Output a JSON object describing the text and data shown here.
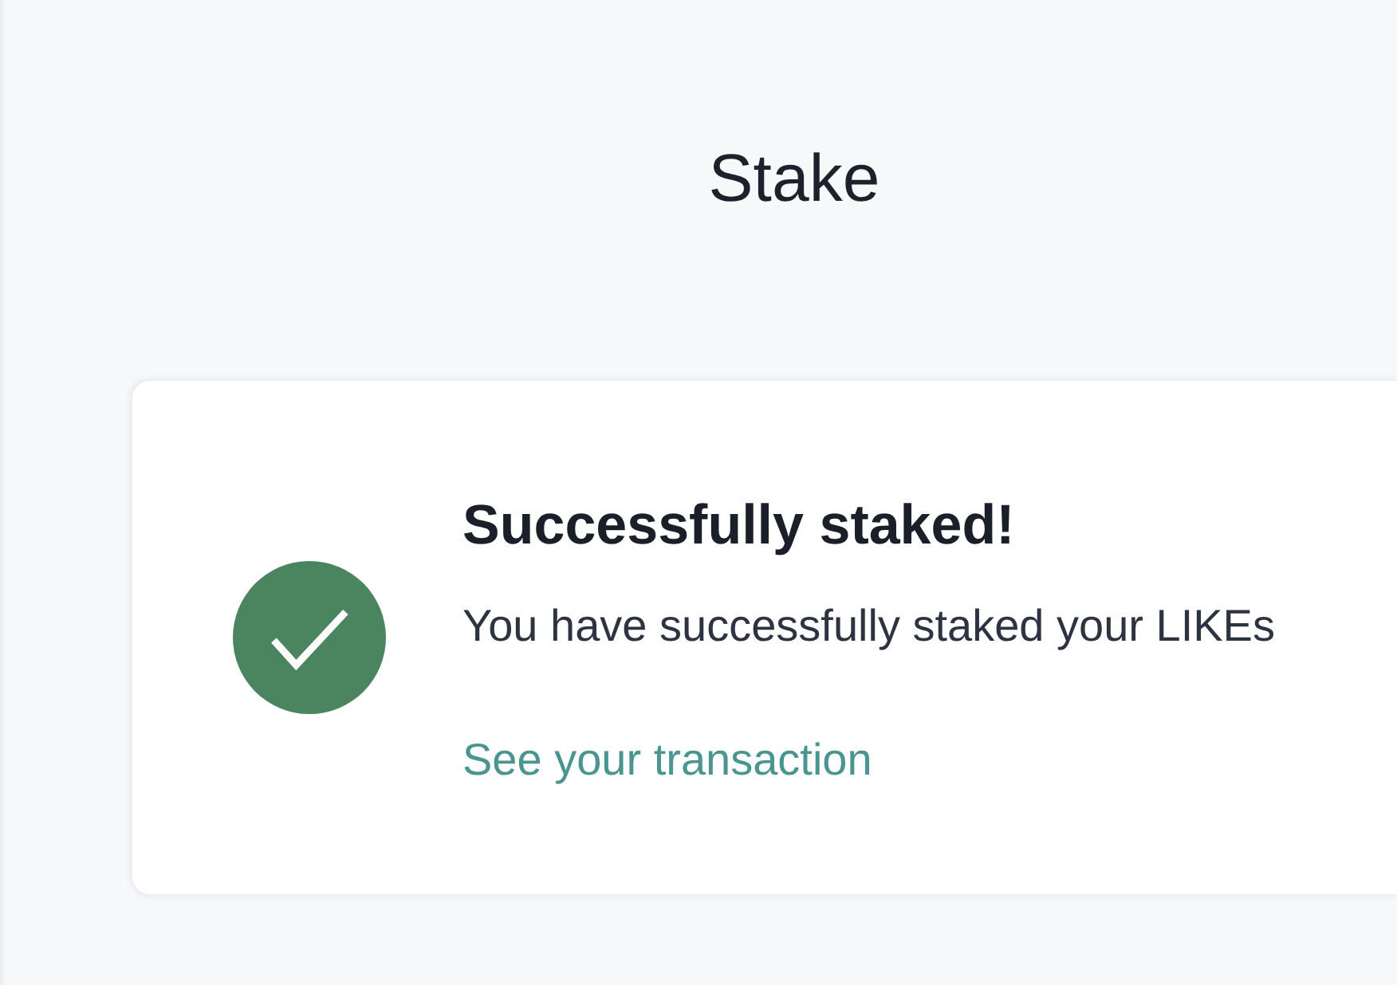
{
  "page": {
    "title": "Stake"
  },
  "result_card": {
    "succeeded": true,
    "heading": "Successfully staked!",
    "message": "You have successfully staked your LIKEs",
    "link": "See your transaction"
  }
}
